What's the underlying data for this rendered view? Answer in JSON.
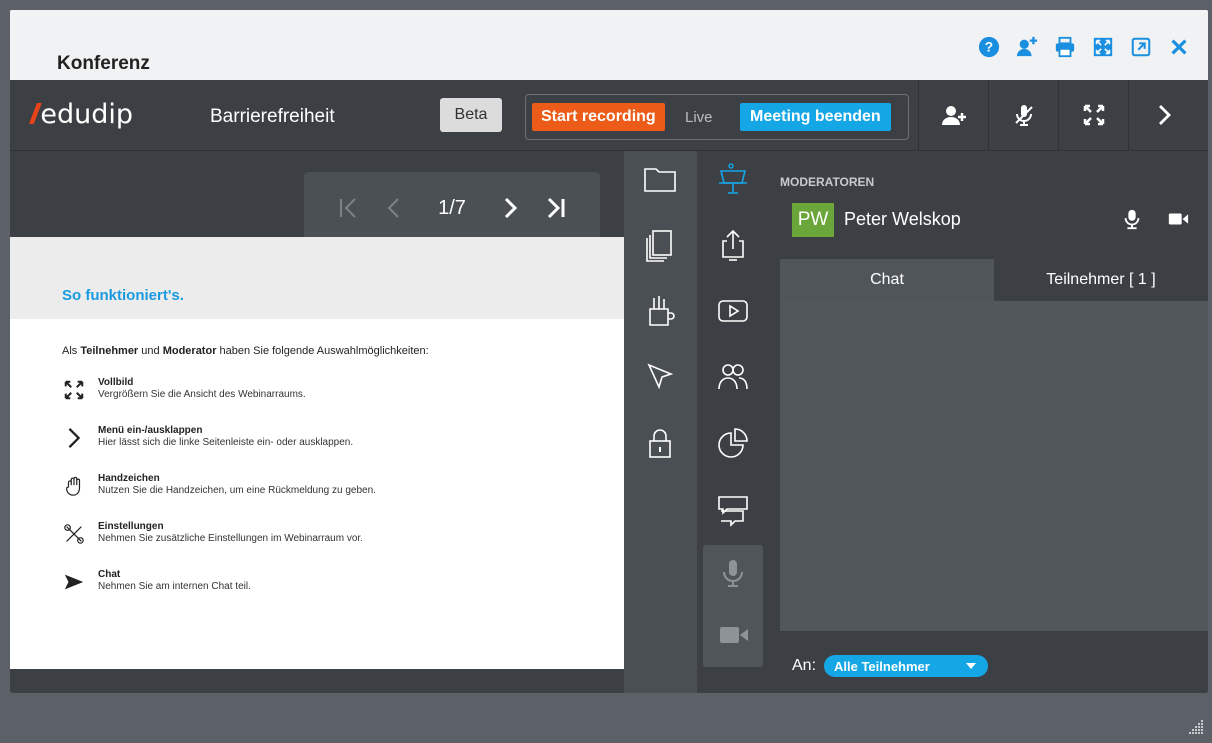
{
  "window": {
    "title": "Konferenz",
    "icons": [
      "help-icon",
      "add-user-icon",
      "print-icon",
      "fullscreen-icon",
      "popout-icon",
      "close-icon"
    ]
  },
  "topbar": {
    "logo_text": "edudip",
    "logo_slashes": "///",
    "title": "Barrierefreiheit",
    "beta_label": "Beta",
    "start_recording": "Start recording",
    "live": "Live",
    "end_meeting": "Meeting beenden"
  },
  "pager": {
    "indicator": "1/7"
  },
  "slide": {
    "title": "So funktioniert's.",
    "intro_prefix": "Als ",
    "intro_role1": "Teilnehmer",
    "intro_mid": " und ",
    "intro_role2": "Moderator",
    "intro_suffix": " haben Sie folgende Auswahlmöglichkeiten:",
    "features": [
      {
        "name": "Vollbild",
        "desc": "Vergrößern Sie die Ansicht des Webinarraums.",
        "icon": "fullscreen-icon"
      },
      {
        "name": "Menü ein-/ausklappen",
        "desc": "Hier lässt sich die linke Seitenleiste ein- oder ausklappen.",
        "icon": "chevron-right-icon"
      },
      {
        "name": "Handzeichen",
        "desc": "Nutzen Sie die Handzeichen, um eine Rückmeldung zu geben.",
        "icon": "hand-icon"
      },
      {
        "name": "Einstellungen",
        "desc": "Nehmen Sie zusätzliche Einstellungen im Webinarraum vor.",
        "icon": "tools-icon"
      },
      {
        "name": "Chat",
        "desc": "Nehmen Sie am internen Chat teil.",
        "icon": "send-icon"
      }
    ]
  },
  "right_panel": {
    "moderators_label": "MODERATOREN",
    "moderator": {
      "initials": "PW",
      "name": "Peter Welskop"
    },
    "tabs": [
      {
        "label": "Chat",
        "active": true
      },
      {
        "label": "Teilnehmer [ 1 ]",
        "active": false
      }
    ],
    "to_label": "An:",
    "recipient": "Alle Teilnehmer"
  },
  "colors": {
    "accent": "#15a6e6",
    "record": "#ec5b17",
    "avatar": "#6aa63a",
    "dark": "#3c4045"
  }
}
